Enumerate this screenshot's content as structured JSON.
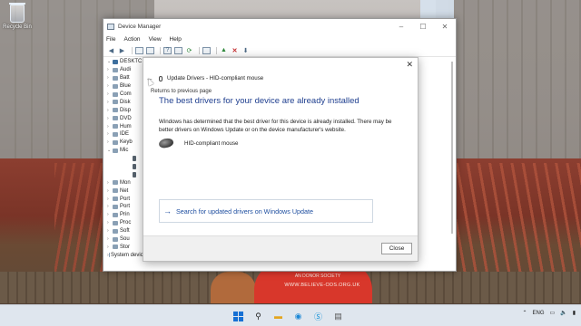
{
  "desktop": {
    "recycle_bin_label": "Recycle Bin",
    "sign_line1": "AN DONOR SOCIETY",
    "sign_line2": "WWW.BELIEVE-ODS.ORG.UK"
  },
  "device_manager": {
    "title": "Device Manager",
    "menu": [
      "File",
      "Action",
      "View",
      "Help"
    ],
    "tree": [
      {
        "label": "DESKTC",
        "level": "root",
        "expanded": true
      },
      {
        "label": "Audi",
        "level": 1
      },
      {
        "label": "Batt",
        "level": 1
      },
      {
        "label": "Blue",
        "level": 1
      },
      {
        "label": "Com",
        "level": 1
      },
      {
        "label": "Disk",
        "level": 1
      },
      {
        "label": "Disp",
        "level": 1
      },
      {
        "label": "DVD",
        "level": 1
      },
      {
        "label": "Hum",
        "level": 1
      },
      {
        "label": "IDE",
        "level": 1
      },
      {
        "label": "Keyb",
        "level": 1
      },
      {
        "label": "Mic",
        "level": 1,
        "expanded": true
      },
      {
        "label": "",
        "level": 2
      },
      {
        "label": "",
        "level": 2
      },
      {
        "label": "",
        "level": 2
      },
      {
        "label": "Mon",
        "level": 1
      },
      {
        "label": "Net",
        "level": 1
      },
      {
        "label": "Port",
        "level": 1
      },
      {
        "label": "Port",
        "level": 1
      },
      {
        "label": "Prin",
        "level": 1
      },
      {
        "label": "Proc",
        "level": 1
      },
      {
        "label": "Soft",
        "level": 1
      },
      {
        "label": "Sou",
        "level": 1
      },
      {
        "label": "Stor",
        "level": 1
      },
      {
        "label": "System devices",
        "level": 1
      }
    ]
  },
  "update_drivers": {
    "header": "Update Drivers - HID-compliant mouse",
    "back_tooltip": "Returns to previous page",
    "heading": "The best drivers for your device are already installed",
    "description": "Windows has determined that the best driver for this device is already installed. There may be better drivers on Windows Update or on the device manufacturer's website.",
    "device_name": "HID-compliant mouse",
    "link_text": "Search for updated drivers on Windows Update",
    "close_button": "Close"
  },
  "taskbar": {
    "language": "ENG",
    "pinned": [
      "start",
      "search",
      "file-explorer",
      "edge",
      "skype",
      "device-manager"
    ]
  }
}
